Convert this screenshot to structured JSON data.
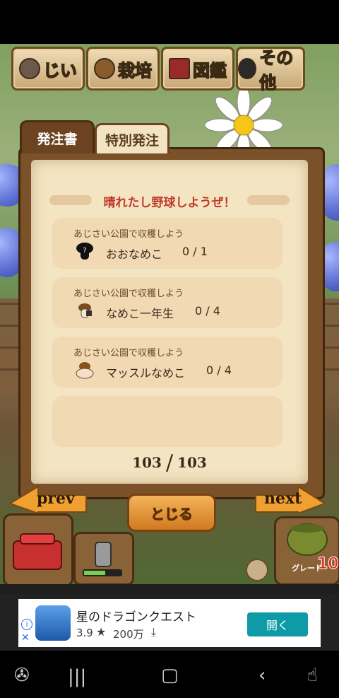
{
  "top_menu": {
    "items": [
      {
        "label": "じい",
        "icon": "jii-face-icon"
      },
      {
        "label": "栽培",
        "icon": "mushroom-planting-icon"
      },
      {
        "label": "図鑑",
        "icon": "book-icon"
      },
      {
        "label": "その他",
        "icon": "magnifier-icon"
      }
    ]
  },
  "tabs": {
    "order": "発注書",
    "special": "特別発注"
  },
  "order_sheet": {
    "title": "晴れたし野球しようぜ！",
    "orders": [
      {
        "location": "あじさい公園で収穫しよう",
        "name": "おおなめこ",
        "count": "0 / 1",
        "icon": "unknown-nameko-icon"
      },
      {
        "location": "あじさい公園で収穫しよう",
        "name": "なめこ一年生",
        "count": "0 / 4",
        "icon": "nameko-student-icon"
      },
      {
        "location": "あじさい公園で収穫しよう",
        "name": "マッスルなめこ",
        "count": "0 / 4",
        "icon": "muscle-nameko-icon"
      }
    ],
    "page_current": "103",
    "page_total": "103"
  },
  "nav": {
    "prev": "prev",
    "next": "next",
    "close": "とじる"
  },
  "game_buttons": {
    "grade_label": "グレード",
    "grade_value": "10"
  },
  "ad": {
    "title": "星のドラゴンクエスト",
    "rating": "3.9",
    "downloads": "200万",
    "cta": "開く"
  },
  "colors": {
    "title_red": "#c0392b",
    "board_brown": "#7a5128",
    "paper": "#f3e4c2",
    "ad_cta": "#0f9aa8"
  }
}
